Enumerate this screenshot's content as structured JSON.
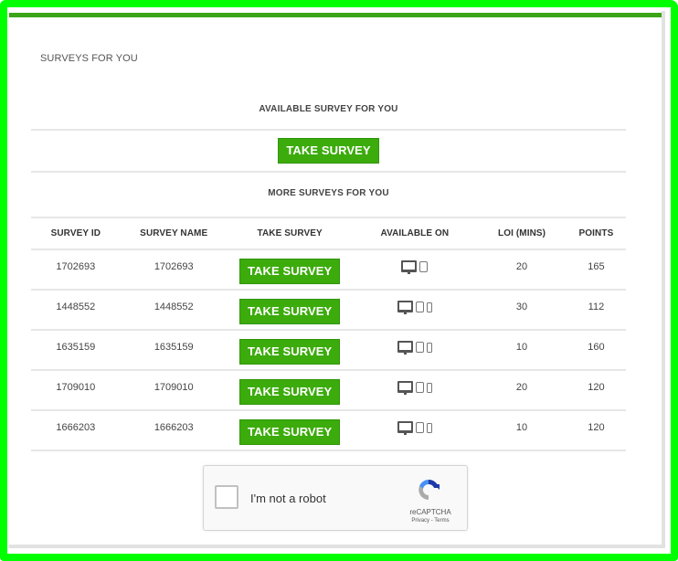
{
  "colors": {
    "frame_border": "#00ff00",
    "top_bar": "#3aa517",
    "button_bg": "#3cab0c",
    "button_text": "#ffffff"
  },
  "page": {
    "section_title": "SURVEYS FOR YOU"
  },
  "available": {
    "heading": "AVAILABLE SURVEY FOR YOU",
    "button_label": "TAKE SURVEY"
  },
  "more": {
    "heading": "MORE SURVEYS FOR YOU",
    "columns": [
      "SURVEY ID",
      "SURVEY NAME",
      "TAKE SURVEY",
      "AVAILABLE ON",
      "LOI (MINS)",
      "POINTS"
    ],
    "rows": [
      {
        "id": "1702693",
        "name": "1702693",
        "button_label": "TAKE SURVEY",
        "devices": [
          "desktop-icon",
          "tablet-icon"
        ],
        "loi": "20",
        "points": "165"
      },
      {
        "id": "1448552",
        "name": "1448552",
        "button_label": "TAKE SURVEY",
        "devices": [
          "desktop-icon",
          "tablet-icon",
          "phone-icon"
        ],
        "loi": "30",
        "points": "112"
      },
      {
        "id": "1635159",
        "name": "1635159",
        "button_label": "TAKE SURVEY",
        "devices": [
          "desktop-icon",
          "tablet-icon",
          "phone-icon"
        ],
        "loi": "10",
        "points": "160"
      },
      {
        "id": "1709010",
        "name": "1709010",
        "button_label": "TAKE SURVEY",
        "devices": [
          "desktop-icon",
          "tablet-icon",
          "phone-icon"
        ],
        "loi": "20",
        "points": "120"
      },
      {
        "id": "1666203",
        "name": "1666203",
        "button_label": "TAKE SURVEY",
        "devices": [
          "desktop-icon",
          "tablet-icon",
          "phone-icon"
        ],
        "loi": "10",
        "points": "120"
      }
    ]
  },
  "captcha": {
    "label": "I'm not a robot",
    "brand": "reCAPTCHA",
    "links": "Privacy - Terms",
    "checked": false
  }
}
